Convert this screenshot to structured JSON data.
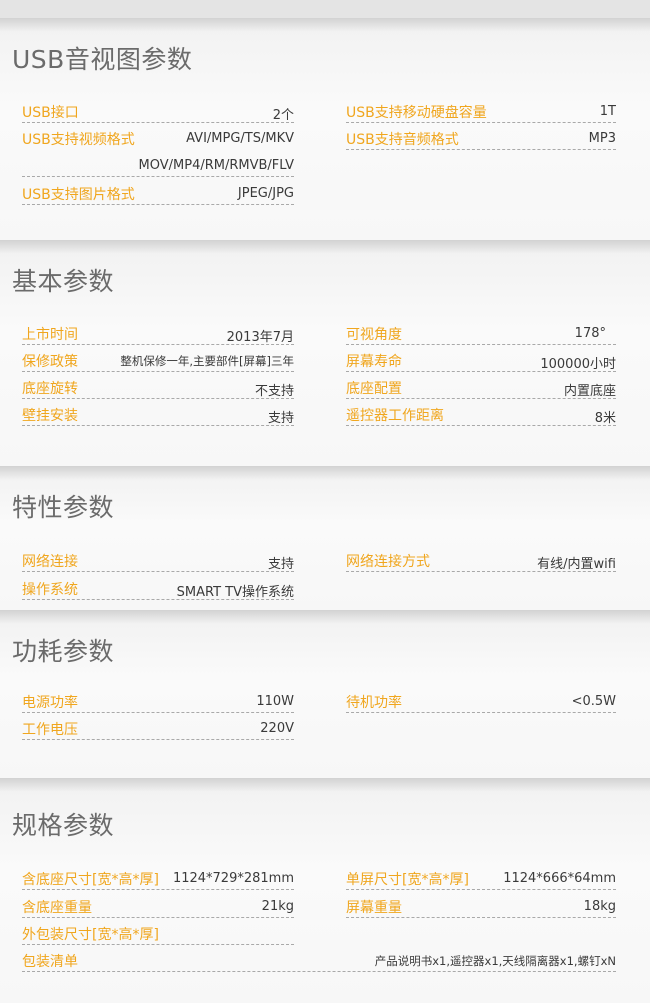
{
  "sections": [
    {
      "title": "USB音视图参数",
      "left": [
        {
          "label": "USB接口",
          "value": "2个"
        },
        {
          "label": "USB支持视频格式",
          "value": "AVI/MPG/TS/MKV"
        },
        {
          "label": "",
          "value": "MOV/MP4/RM/RMVB/FLV"
        },
        {
          "label": "USB支持图片格式",
          "value": "JPEG/JPG"
        }
      ],
      "right": [
        {
          "label": "USB支持移动硬盘容量",
          "value": "1T"
        },
        {
          "label": "USB支持音频格式",
          "value": "MP3"
        }
      ]
    },
    {
      "title": "基本参数",
      "left": [
        {
          "label": "上市时间",
          "value": "2013年7月"
        },
        {
          "label": "保修政策",
          "value": "整机保修一年,主要部件[屏幕]三年"
        },
        {
          "label": "底座旋转",
          "value": "不支持"
        },
        {
          "label": "壁挂安装",
          "value": "支持"
        }
      ],
      "right": [
        {
          "label": "可视角度",
          "value": "178°"
        },
        {
          "label": "屏幕寿命",
          "value": "100000小时"
        },
        {
          "label": "底座配置",
          "value": "内置底座"
        },
        {
          "label": "遥控器工作距离",
          "value": "8米"
        }
      ]
    },
    {
      "title": "特性参数",
      "left": [
        {
          "label": "网络连接",
          "value": "支持"
        },
        {
          "label": "操作系统",
          "value": "SMART TV操作系统"
        }
      ],
      "right": [
        {
          "label": "网络连接方式",
          "value": "有线/内置wifi"
        }
      ]
    },
    {
      "title": "功耗参数",
      "left": [
        {
          "label": "电源功率",
          "value": "110W"
        },
        {
          "label": "工作电压",
          "value": "220V"
        }
      ],
      "right": [
        {
          "label": "待机功率",
          "value": "<0.5W"
        }
      ]
    },
    {
      "title": "规格参数",
      "left": [
        {
          "label": "含底座尺寸[宽*高*厚]",
          "value": "1124*729*281mm"
        },
        {
          "label": "含底座重量",
          "value": "21kg"
        },
        {
          "label": "外包装尺寸[宽*高*厚]",
          "value": ""
        }
      ],
      "right": [
        {
          "label": "单屏尺寸[宽*高*厚]",
          "value": "1124*666*64mm"
        },
        {
          "label": "屏幕重量",
          "value": "18kg"
        }
      ],
      "full": [
        {
          "label": "包装清单",
          "value": "产品说明书x1,遥控器x1,天线隔离器x1,螺钉xN"
        }
      ]
    }
  ]
}
